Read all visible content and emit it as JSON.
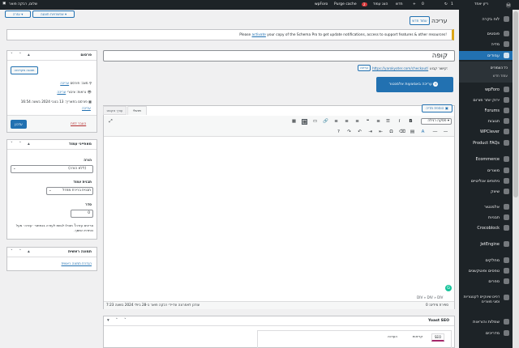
{
  "admin_bar": {
    "right_items": [
      "ריזן יאחד",
      "1",
      "0",
      "חדש",
      "הצג עמוד"
    ],
    "badge_count": "2",
    "items_left": [
      "Purge cache",
      "wpForo"
    ],
    "user_greeting": "שלום, רבקה פואר"
  },
  "sidebar": {
    "items": [
      {
        "label": "לוח בקרה",
        "icon": "dashboard-icon"
      },
      {
        "label": "פוסטים",
        "icon": "pin-icon"
      },
      {
        "label": "מדיה",
        "icon": "media-icon"
      },
      {
        "label": "עמודים",
        "icon": "page-icon"
      },
      {
        "label": "wpForo",
        "icon": "forum-icon"
      },
      {
        "label": "ירוק יותר פורום",
        "icon": "forum-icon"
      },
      {
        "label": "Forums",
        "icon": "forum-icon"
      },
      {
        "label": "תגובות",
        "icon": "comment-icon"
      },
      {
        "label": "WPClever",
        "icon": "plugin-icon"
      },
      {
        "label": "Product FAQs",
        "icon": "faq-icon"
      },
      {
        "label": "Ecommerce",
        "icon": "woo-icon"
      },
      {
        "label": "מוצרים",
        "icon": "product-icon"
      },
      {
        "label": "ניתוחים אנליטיים",
        "icon": "chart-icon"
      },
      {
        "label": "שיווק",
        "icon": "marketing-icon"
      },
      {
        "label": "אלמנטור",
        "icon": "elementor-icon"
      },
      {
        "label": "תבניות",
        "icon": "template-icon"
      },
      {
        "label": "Crocoblock",
        "icon": "crocoblock-icon"
      },
      {
        "label": "JetEngine",
        "icon": "jetengine-icon"
      },
      {
        "label": "מחלקים",
        "icon": "tool-icon"
      },
      {
        "label": "טפסים ופוטקשנים",
        "icon": "form-icon"
      },
      {
        "label": "ספרים",
        "icon": "book-icon"
      },
      {
        "label": "דפים שיווקיים לקטגוריות וסוגי מוצרים",
        "icon": "page-icon"
      },
      {
        "label": "שמלות והוראות",
        "icon": "appearance-icon"
      },
      {
        "label": "מדריכים",
        "icon": "guide-icon"
      }
    ],
    "submenu": [
      "כל העמודים",
      "עמוד חדש"
    ]
  },
  "header": {
    "title": "עריכה",
    "add_new": "עמוד חדש",
    "screen_options": "אפשרויות תצוגה",
    "help": "עזרה"
  },
  "notice": {
    "text_before": "Please ",
    "link": "activate",
    "text_after": " your copy of the Schema Pro to get update notifications, access to support features & other resources!"
  },
  "editor": {
    "title_value": "קופה",
    "permalink_label": "קישור קבוע:",
    "permalink_url": "https://yarokyoter.com/checkout/",
    "edit_permalink": "עריכה",
    "elementor_button": "עריכה באמצעות אלמנטור",
    "add_media": "הוספת מדיה",
    "tab_visual": "ויזואלי",
    "tab_code": "עורך טקסט",
    "format_select": "פסקה רגילה",
    "path": "DIV » DIV » DIV",
    "word_count": "ספירת מילים: 0",
    "last_edit": "עודכן לאחרונה על-ידי רבקה פואר ב-28 ביולי 2024 בשעה 7:23"
  },
  "publish_box": {
    "title": "פרסום",
    "preview": "תצוגה מקדימה",
    "status_label": "מצב: פורסם",
    "status_edit": "עריכה",
    "visibility_label": "נראות: ציבורי",
    "visibility_edit": "עריכה",
    "published_label": "פורסם בתאריך: 13 בנובי 2024 בשעה 16:54",
    "published_edit": "עריכה",
    "trash": "העבר לפח",
    "update": "עדכון"
  },
  "attributes_box": {
    "title": "מאפייני עמוד",
    "parent_label": "הורה",
    "parent_value": "(ללא הורה)",
    "template_label": "תבנית עמוד",
    "template_value": "תבנית ברירת מחדל",
    "order_label": "סדר",
    "order_value": "0",
    "help_text": "צריכים עזרה? תוכלו לגשת לעזרה בכפתור ׳עזרה׳ מעל כותרת המסך."
  },
  "featured_box": {
    "title": "תמונה ראשית",
    "link": "הגדרת תמונה ראשית"
  },
  "yoast": {
    "title": "Yoast SEO",
    "tabs": [
      "SEO",
      "קריאות",
      "הערכה"
    ]
  },
  "colors": {
    "accent": "#2271b1",
    "adminbar": "#1d2327",
    "notice_border": "#dba617",
    "badge": "#d63638"
  }
}
